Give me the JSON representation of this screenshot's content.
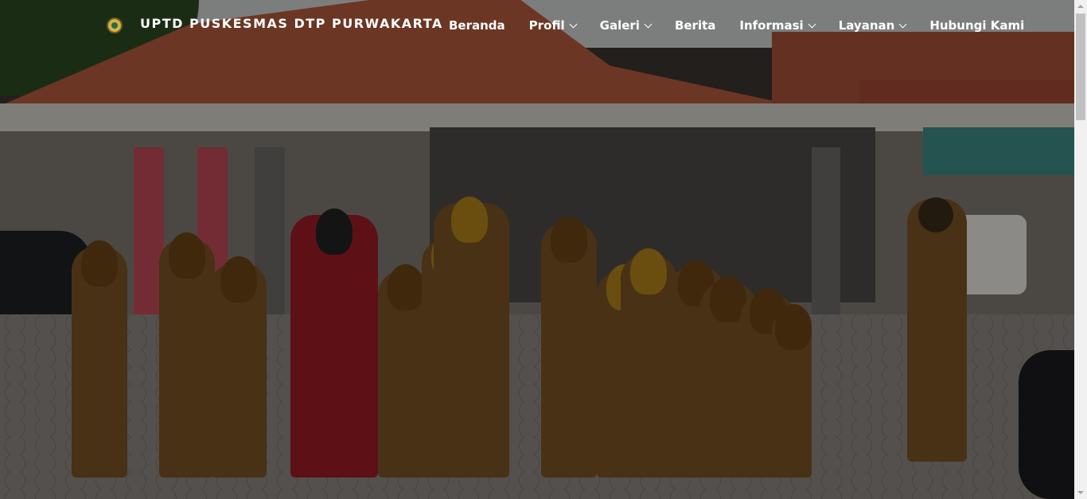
{
  "brand": {
    "name": "UPTD PUSKESMAS DTP PURWAKARTA",
    "logo_icon": "emblem-logo-icon"
  },
  "nav": {
    "items": [
      {
        "label": "Beranda",
        "has_dropdown": false
      },
      {
        "label": "Profil",
        "has_dropdown": true
      },
      {
        "label": "Galeri",
        "has_dropdown": true
      },
      {
        "label": "Berita",
        "has_dropdown": false
      },
      {
        "label": "Informasi",
        "has_dropdown": true
      },
      {
        "label": "Layanan",
        "has_dropdown": true
      },
      {
        "label": "Hubungi Kami",
        "has_dropdown": false
      }
    ],
    "dropdown_icon": "chevron-down-icon"
  },
  "hero": {
    "background": "photo-staff-assembly-in-front-of-puskesmas-building",
    "overlay_color": "#000000",
    "overlay_opacity": 0.4
  },
  "colors": {
    "nav_text": "#ffffff",
    "scrollbar_track": "#f1f1f1",
    "scrollbar_thumb": "#c1c1c1"
  }
}
